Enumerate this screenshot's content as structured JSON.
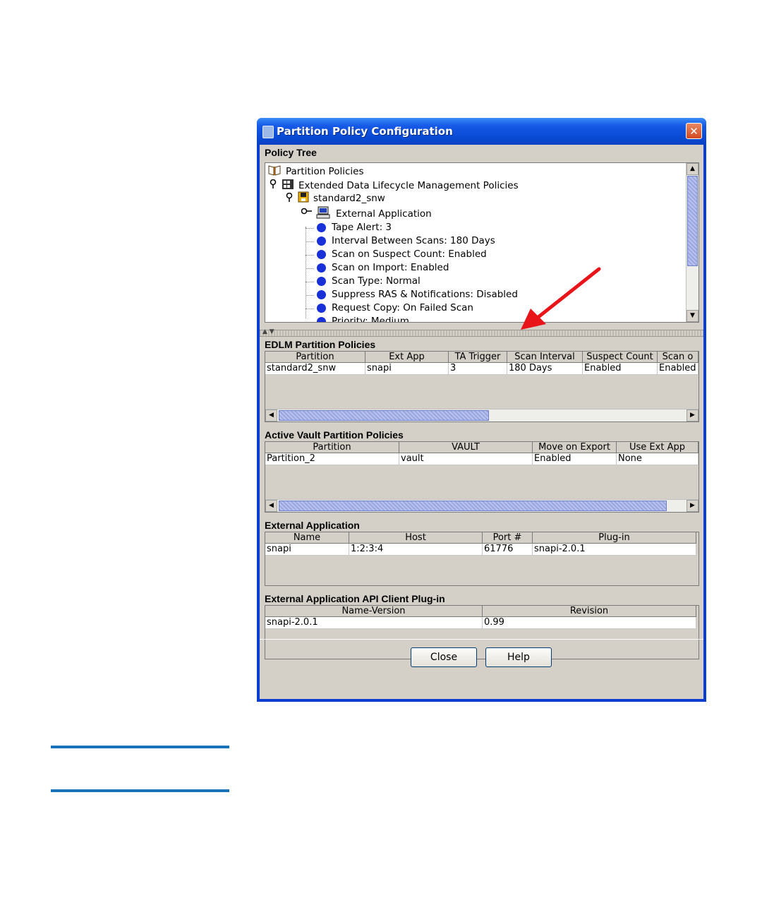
{
  "window": {
    "title": "Partition Policy Configuration",
    "close_glyph": "✕"
  },
  "policy_tree": {
    "label": "Policy Tree",
    "items": [
      {
        "text": "Partition Policies",
        "icon": "book-icon"
      },
      {
        "text": "Extended Data Lifecycle Management Policies",
        "icon": "server-icon"
      },
      {
        "text": "standard2_snw",
        "icon": "disk-icon"
      },
      {
        "text": "External Application",
        "icon": "computer-icon"
      },
      {
        "text": "Tape Alert: 3"
      },
      {
        "text": "Interval Between Scans: 180 Days"
      },
      {
        "text": "Scan on Suspect Count: Enabled"
      },
      {
        "text": "Scan on Import: Enabled"
      },
      {
        "text": "Scan Type: Normal"
      },
      {
        "text": "Suppress RAS & Notifications: Disabled"
      },
      {
        "text": "Request Copy: On Failed Scan"
      },
      {
        "text": "Priority: Medium"
      }
    ]
  },
  "edlm": {
    "label": "EDLM Partition Policies",
    "columns": [
      "Partition",
      "Ext App",
      "TA Trigger",
      "Scan Interval",
      "Suspect Count",
      "Scan o"
    ],
    "rows": [
      [
        "standard2_snw",
        "snapi",
        "3",
        "180 Days",
        "Enabled",
        "Enabled"
      ]
    ]
  },
  "active_vault": {
    "label": "Active Vault Partition Policies",
    "columns": [
      "Partition",
      "VAULT",
      "Move on Export",
      "Use Ext App"
    ],
    "rows": [
      [
        "Partition_2",
        "vault",
        "Enabled",
        "None"
      ]
    ]
  },
  "external_application": {
    "label": "External Application",
    "columns": [
      "Name",
      "Host",
      "Port #",
      "Plug-in"
    ],
    "rows": [
      [
        "snapi",
        "1:2:3:4",
        "61776",
        "snapi-2.0.1"
      ]
    ]
  },
  "plugin": {
    "label": "External Application API Client Plug-in",
    "columns": [
      "Name-Version",
      "Revision"
    ],
    "rows": [
      [
        "snapi-2.0.1",
        "0.99"
      ]
    ]
  },
  "buttons": {
    "close": "Close",
    "help": "Help"
  },
  "colors": {
    "title_bar": "#0a4bd6",
    "annotation_arrow": "#e8141a",
    "page_rule": "#1a72b8"
  }
}
